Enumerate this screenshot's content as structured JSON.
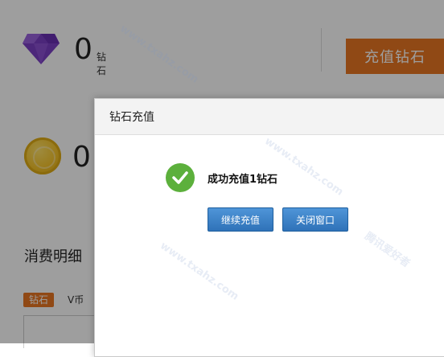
{
  "account": {
    "diamond_count": "0",
    "diamond_unit": "钻石",
    "recharge_button": "充值钻石",
    "coin_count": "0"
  },
  "history": {
    "title": "消费明细",
    "tabs": [
      "钻石",
      "V币"
    ]
  },
  "dialog": {
    "title": "钻石充值",
    "message": "成功充值1钻石",
    "continue_button": "继续充值",
    "close_button": "关闭窗口"
  },
  "watermark": {
    "text": "www.txahz.com",
    "brand": "腾讯爱好者"
  },
  "colors": {
    "accent_orange": "#e87722",
    "success_green": "#5cb03c",
    "button_blue": "#3a80c6",
    "overlay": "rgba(0,0,0,0.38)"
  }
}
